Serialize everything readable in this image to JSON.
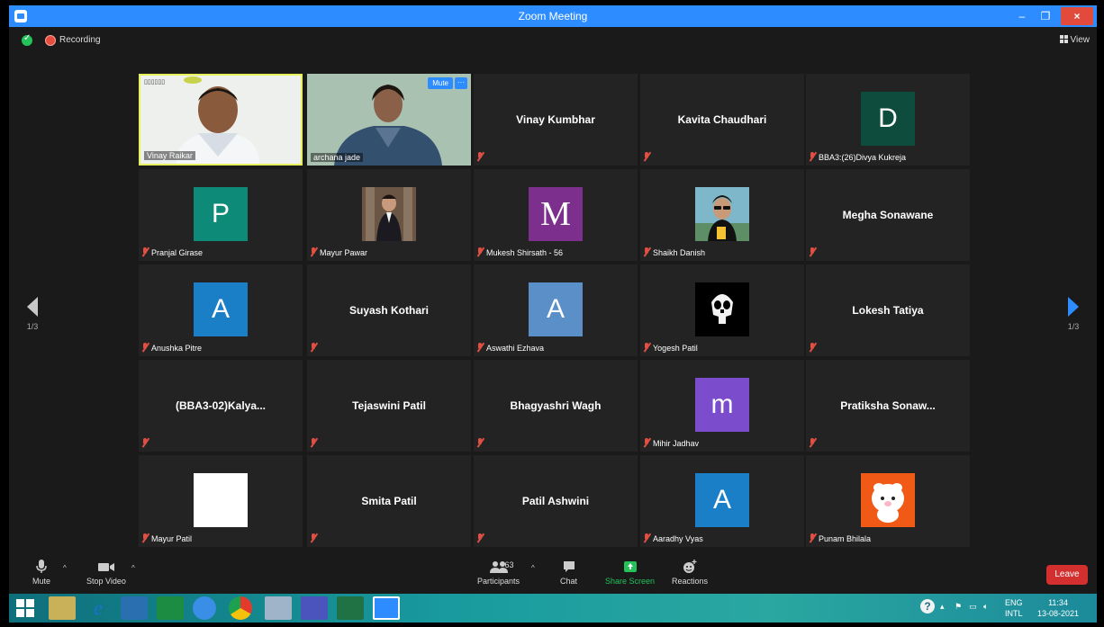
{
  "window": {
    "title": "Zoom Meeting",
    "minimize": "–",
    "restore": "❐",
    "close": "×"
  },
  "status": {
    "recording_label": "Recording",
    "view_label": "View"
  },
  "pagination": {
    "prev_page": "1/3",
    "next_page": "1/3"
  },
  "tiles": [
    {
      "name": "Vinay Raikar",
      "kind": "video"
    },
    {
      "name": "archana jade",
      "kind": "video",
      "mute_label": "Mute",
      "more_label": "···"
    },
    {
      "name": "Vinay Kumbhar",
      "kind": "name"
    },
    {
      "name": "Kavita Chaudhari",
      "kind": "name"
    },
    {
      "name": "BBA3:(26)Divya Kukreja",
      "kind": "avatar",
      "letter": "D",
      "color": "#0e4c3e"
    },
    {
      "name": "Pranjal Girase",
      "kind": "avatar",
      "letter": "P",
      "color": "#0e8a78"
    },
    {
      "name": "Mayur Pawar",
      "kind": "photo"
    },
    {
      "name": "Mukesh Shirsath - 56",
      "kind": "avatar",
      "letter": "M",
      "color": "#7c2f8c"
    },
    {
      "name": "Shaikh Danish",
      "kind": "photo"
    },
    {
      "name": "Megha Sonawane",
      "kind": "name"
    },
    {
      "name": "Anushka Pitre",
      "kind": "avatar",
      "letter": "A",
      "color": "#1a7fc7"
    },
    {
      "name": "Suyash Kothari",
      "kind": "name"
    },
    {
      "name": "Aswathi Ezhava",
      "kind": "avatar",
      "letter": "A",
      "color": "#5b8fc8"
    },
    {
      "name": "Yogesh Patil",
      "kind": "photo"
    },
    {
      "name": "Lokesh Tatiya",
      "kind": "name"
    },
    {
      "name": "(BBA3-02)Kalya...",
      "kind": "name"
    },
    {
      "name": "Tejaswini Patil",
      "kind": "name"
    },
    {
      "name": "Bhagyashri Wagh",
      "kind": "name"
    },
    {
      "name": "Mihir Jadhav",
      "kind": "avatar",
      "letter": "m",
      "color": "#7b4dcc"
    },
    {
      "name": "Pratiksha Sonaw...",
      "kind": "name"
    },
    {
      "name": "Mayur Patil",
      "kind": "avatar",
      "letter": "",
      "color": "#ffffff"
    },
    {
      "name": "Smita Patil",
      "kind": "name"
    },
    {
      "name": "Patil Ashwini",
      "kind": "name"
    },
    {
      "name": "Aaradhy Vyas",
      "kind": "avatar",
      "letter": "A",
      "color": "#1a7fc7"
    },
    {
      "name": "Punam Bhilala",
      "kind": "photo"
    }
  ],
  "toolbar": {
    "mute_label": "Mute",
    "stop_video_label": "Stop Video",
    "participants_label": "Participants",
    "participants_count": "63",
    "chat_label": "Chat",
    "share_screen_label": "Share Screen",
    "reactions_label": "Reactions",
    "leave_label": "Leave",
    "share_color": "#23c35a",
    "leave_color": "#d32f2f"
  },
  "taskbar": {
    "lang_top": "ENG",
    "lang_bottom": "INTL",
    "time": "11:34",
    "date": "13-08-2021"
  }
}
